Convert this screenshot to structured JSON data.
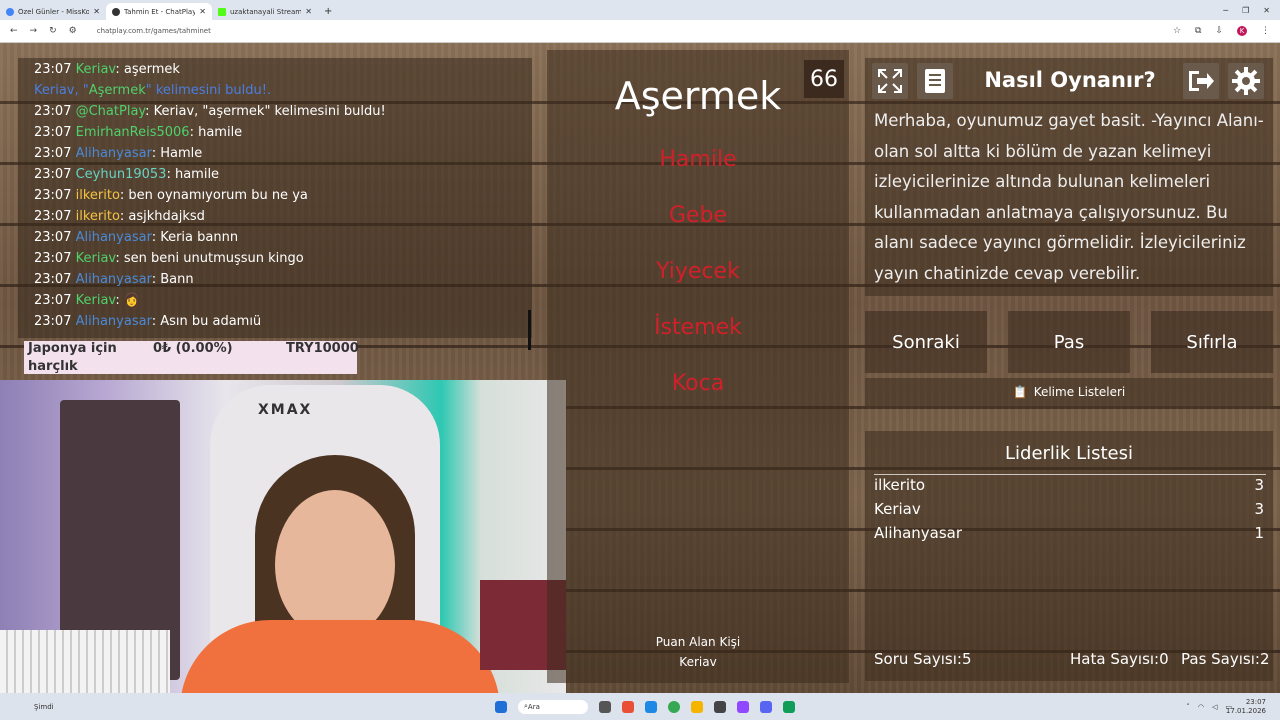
{
  "browser": {
    "tabs": [
      {
        "label": "Özel Günler - MissKo AI Bot S...",
        "favicon": "blue"
      },
      {
        "label": "Tahmin Et - ChatPlay",
        "favicon": "chatplay"
      },
      {
        "label": "uzaktanayali Stream - Kick Da...",
        "favicon": "kick"
      }
    ],
    "url": "chatplay.com.tr/games/tahminet"
  },
  "chat": {
    "messages": [
      {
        "time": "23:07",
        "user": "Keriav",
        "user_color": "green",
        "text": ": aşermek"
      },
      {
        "system": true,
        "pre": "Keriav, \"",
        "highlight": "Aşermek",
        "post": "\" kelimesini buldu!."
      },
      {
        "time": "23:07",
        "user": "@ChatPlay",
        "user_color": "green",
        "text": ": Keriav, \"aşermek\" kelimesini buldu!"
      },
      {
        "time": "23:07",
        "user": "EmirhanReis5006",
        "user_color": "green",
        "text": ": hamile"
      },
      {
        "time": "23:07",
        "user": "Alihanyasar",
        "user_color": "blue",
        "text": ": Hamle"
      },
      {
        "time": "23:07",
        "user": "Ceyhun19053",
        "user_color": "teal",
        "text": ": hamile"
      },
      {
        "time": "23:07",
        "user": "ilkerito",
        "user_color": "gold",
        "text": ": ben oynamıyorum bu ne ya"
      },
      {
        "time": "23:07",
        "user": "ilkerito",
        "user_color": "gold",
        "text": ": asjkhdajksd"
      },
      {
        "time": "23:07",
        "user": "Alihanyasar",
        "user_color": "blue",
        "text": ": Keria bannn"
      },
      {
        "time": "23:07",
        "user": "Keriav",
        "user_color": "green",
        "text": ": sen beni unutmuşsun kingo"
      },
      {
        "time": "23:07",
        "user": "Alihanyasar",
        "user_color": "blue",
        "text": ": Bann"
      },
      {
        "time": "23:07",
        "user": "Keriav",
        "user_color": "green",
        "text": ": 👩"
      },
      {
        "time": "23:07",
        "user": "Alihanyasar",
        "user_color": "blue",
        "text": ": Asın bu adamıü"
      }
    ]
  },
  "donation": {
    "goal_name_line1": "Japonya için",
    "goal_name_line2": "harçlık",
    "progress": "0₺ (0.00%)",
    "target": "TRY10000"
  },
  "webcam": {
    "chair_brand": "XMAX"
  },
  "game": {
    "timer": "66",
    "main_word": "Aşermek",
    "taboo_words": [
      "Hamile",
      "Gebe",
      "Yiyecek",
      "İstemek",
      "Koca"
    ],
    "scorer_label": "Puan Alan Kişi",
    "scorer_name": "Keriav"
  },
  "help": {
    "title": "Nasıl Oynanır?",
    "text": "Merhaba, oyunumuz gayet basit. -Yayıncı Alanı- olan sol altta ki bölüm de yazan kelimeyi izleyicilerinize altında bulunan kelimeleri kullanmadan anlatmaya çalışıyorsunuz. Bu alanı sadece yayıncı görmelidir. İzleyicileriniz yayın chatinizde cevap verebilir."
  },
  "controls": {
    "next": "Sonraki",
    "pass": "Pas",
    "reset": "Sıfırla",
    "word_lists": "Kelime Listeleri"
  },
  "leaderboard": {
    "title": "Liderlik Listesi",
    "rows": [
      {
        "name": "ilkerito",
        "score": "3"
      },
      {
        "name": "Keriav",
        "score": "3"
      },
      {
        "name": "Alihanyasar",
        "score": "1"
      }
    ],
    "question_count_label": "Soru Sayısı:",
    "question_count": "5",
    "error_count_label": "Hata Sayısı:",
    "error_count": "0",
    "pass_count_label": "Pas Sayısı:",
    "pass_count": "2"
  },
  "taskbar": {
    "weather": "Şimdi",
    "search": "Ara",
    "time": "23:07",
    "date": "17.01.2026"
  },
  "colors": {
    "taboo": "#d2202a",
    "username_green": "#4fd16b",
    "username_blue": "#4a8ad8",
    "username_gold": "#f5c242",
    "donation_bg": "#f4e1ee"
  }
}
